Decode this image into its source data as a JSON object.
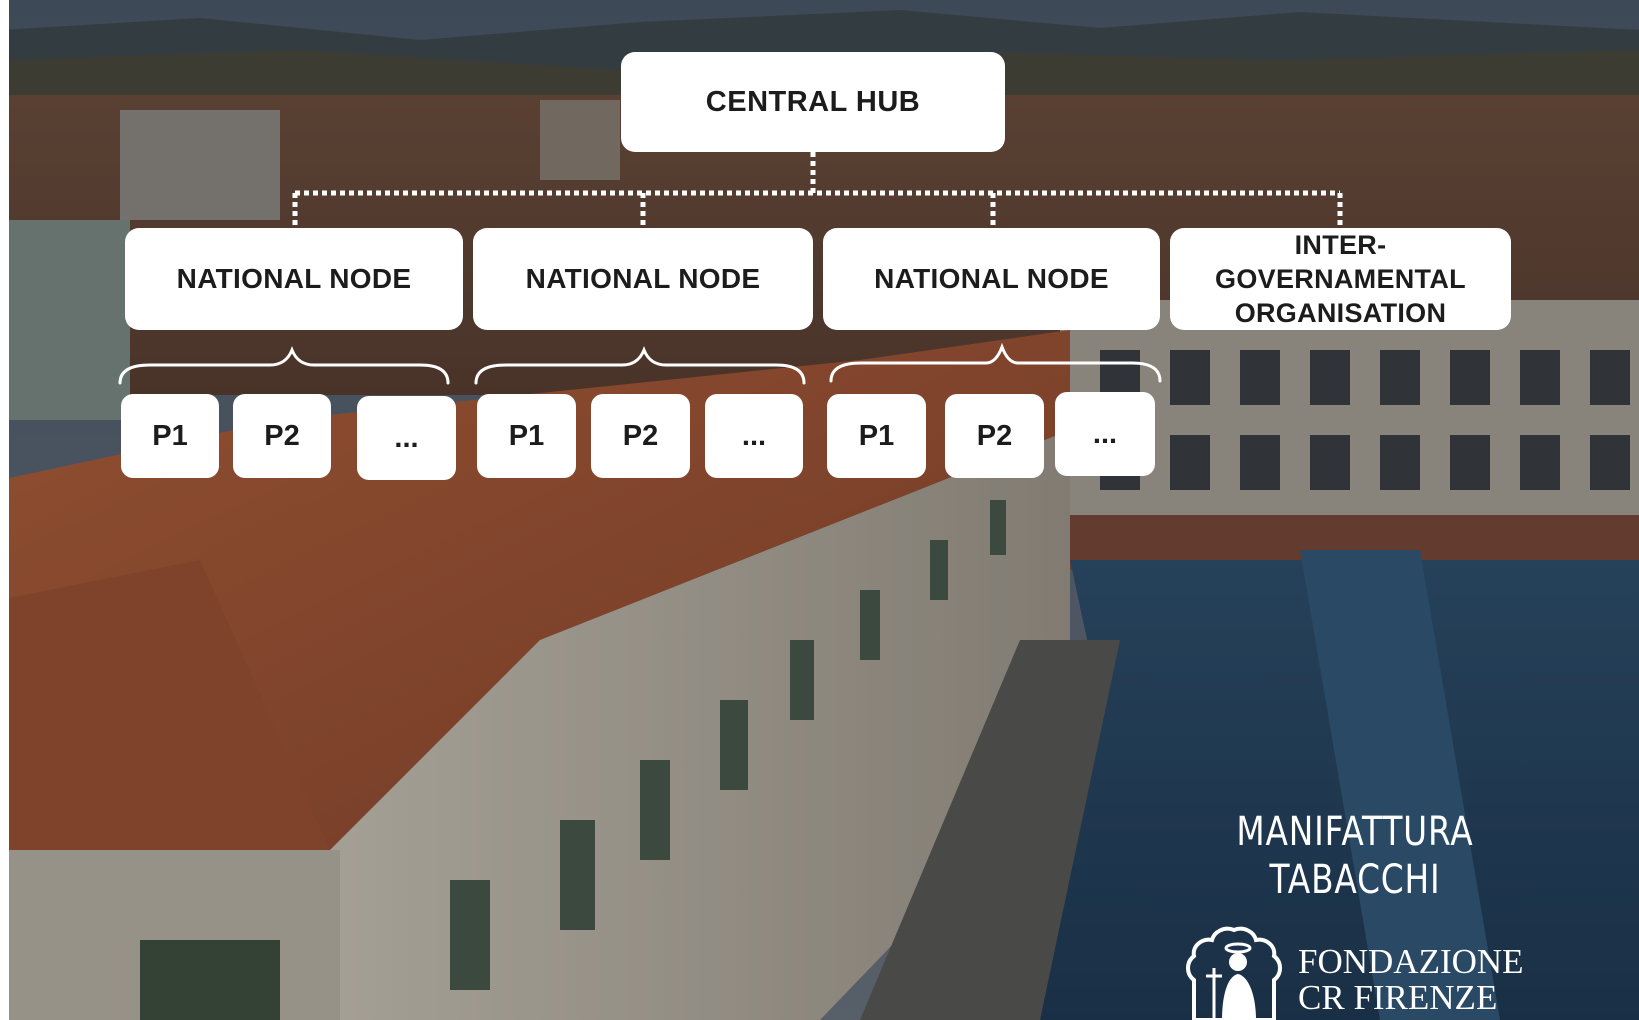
{
  "diagram": {
    "hub": {
      "label": "CENTRAL HUB"
    },
    "national_nodes": [
      {
        "label": "NATIONAL NODE",
        "partners": [
          "P1",
          "P2",
          "..."
        ]
      },
      {
        "label": "NATIONAL NODE",
        "partners": [
          "P1",
          "P2",
          "..."
        ]
      },
      {
        "label": "NATIONAL NODE",
        "partners": [
          "P1",
          "P2",
          "..."
        ]
      }
    ],
    "intergovernmental": {
      "label": "INTER-\nGOVERNAMENTAL\nORGANISATION"
    }
  },
  "branding": {
    "line1": "MANIFATTURA",
    "line2": "TABACCHI",
    "foundation_line1": "FONDAZIONE",
    "foundation_line2": "CR FIRENZE"
  },
  "colors": {
    "box_fill": "#ffffff",
    "box_text": "#1c1c1c",
    "connector": "#ffffff",
    "brand_text": "#ffffff"
  },
  "icons": {
    "emblem": "fondazione-cr-firenze-emblem-icon"
  }
}
